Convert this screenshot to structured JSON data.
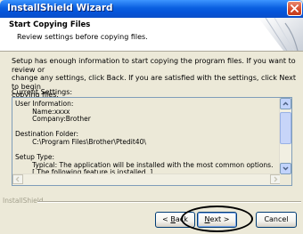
{
  "window": {
    "title": "InstallShield Wizard"
  },
  "header": {
    "title": "Start Copying Files",
    "subtitle": "Review settings before copying files."
  },
  "body": {
    "lines": [
      "Setup has enough information to start copying the program files.  If you want to review or",
      "change any settings, click Back.  If you are satisfied with the settings, click Next to begin",
      "copying files."
    ],
    "settings_label": "Current Settings:",
    "settings_text": "User Information:\n        Name:xxxx\n        Company:Brother\n\nDestination Folder:\n        C:\\Program Files\\Brother\\Ptedit40\\\n\nSetup Type:\n        Typical: The application will be installed with the most common options.\n        [ The following feature is installed. ]"
  },
  "footer": {
    "brand": "InstallShield",
    "back_prefix": "< ",
    "back_hotkey": "B",
    "back_rest": "ack",
    "next_hotkey": "N",
    "next_rest": "ext >",
    "cancel": "Cancel"
  },
  "colors": {
    "titlebar": "#0a5fe0",
    "dialog_bg": "#ece9d8",
    "annotation": "#000000"
  }
}
